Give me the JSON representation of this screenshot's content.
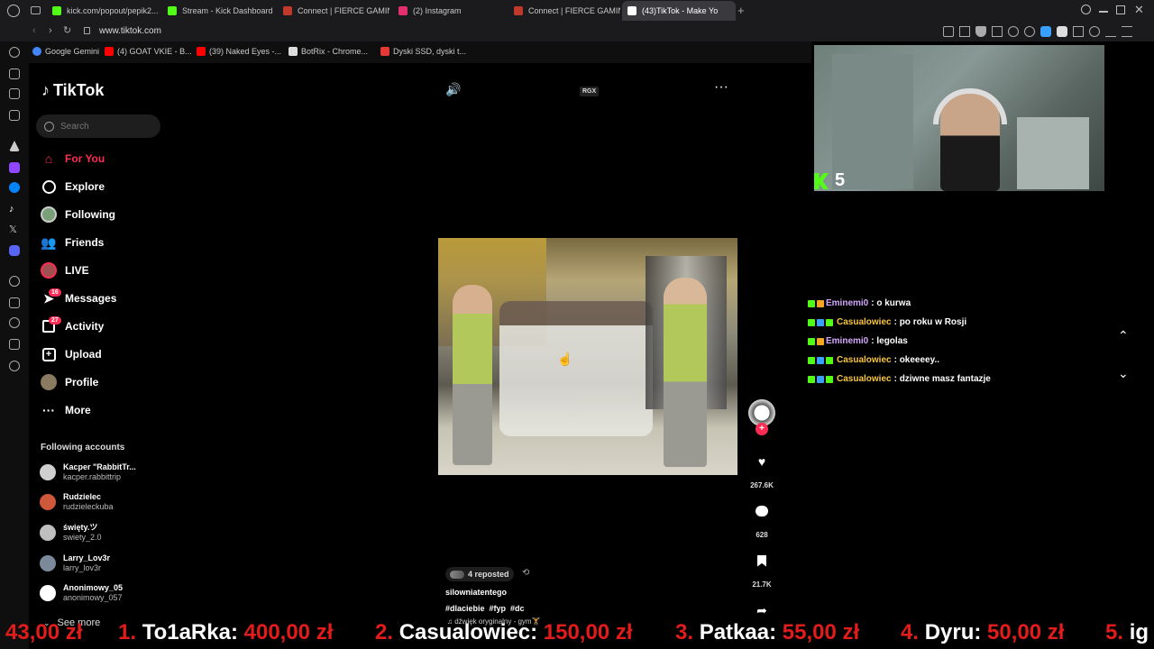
{
  "browser": {
    "tabs": [
      {
        "label": "kick.com/popout/pepik2...",
        "fav": "#53fc18"
      },
      {
        "label": "Stream - Kick Dashboard",
        "fav": "#53fc18"
      },
      {
        "label": "Connect | FIERCE GAMIN",
        "fav": "#c0392b"
      },
      {
        "label": "(2) Instagram",
        "fav": "#e1306c"
      },
      {
        "label": "Connect | FIERCE GAMIN",
        "fav": "#c0392b"
      },
      {
        "label": "(43)TikTok - Make Yo",
        "fav": "#ffffff"
      }
    ],
    "url": "www.tiktok.com",
    "bookmarks": [
      {
        "label": "Google Gemini",
        "fav": "#4285f4"
      },
      {
        "label": "(4) GOAT VKIE - B...",
        "fav": "#ff0000"
      },
      {
        "label": "(39) Naked Eyes -...",
        "fav": "#ff0000"
      },
      {
        "label": "BotRix - Chrome...",
        "fav": "#ffffff"
      },
      {
        "label": "Dyski SSD, dyski t...",
        "fav": "#e53935"
      }
    ]
  },
  "tiktok": {
    "logo": "TikTok",
    "search_placeholder": "Search",
    "nav": [
      {
        "label": "For You",
        "icon": "home-icon"
      },
      {
        "label": "Explore",
        "icon": "compass-icon"
      },
      {
        "label": "Following",
        "icon": "following-icon"
      },
      {
        "label": "Friends",
        "icon": "friends-icon"
      },
      {
        "label": "LIVE",
        "icon": "live-icon"
      },
      {
        "label": "Messages",
        "icon": "messages-icon",
        "badge": "16"
      },
      {
        "label": "Activity",
        "icon": "activity-icon",
        "badge": "27"
      },
      {
        "label": "Upload",
        "icon": "upload-icon"
      },
      {
        "label": "Profile",
        "icon": "profile-icon"
      },
      {
        "label": "More",
        "icon": "more-icon"
      }
    ],
    "following_header": "Following accounts",
    "accounts": [
      {
        "name": "Kacper \"RabbitTr...",
        "handle": "kacper.rabbittrip"
      },
      {
        "name": "Rudzielec",
        "handle": "rudzieleckuba"
      },
      {
        "name": "święty.ツ",
        "handle": "swiety_2.0"
      },
      {
        "name": "Larry_Lov3r",
        "handle": "larry_lov3r"
      },
      {
        "name": "Anonimowy_05",
        "handle": "anonimowy_057"
      }
    ],
    "see_more": "See more",
    "player_badge": "RGX",
    "actions": {
      "likes": "267.6K",
      "comments": "628",
      "saves": "21.7K"
    },
    "reposted": "4 reposted",
    "author": "silowniatentego",
    "hashtags": "#dlaciebie  #fyp  #dc",
    "sound": "♫ dźwięk oryginalny - gym🏋"
  },
  "stream": {
    "viewer_count": "5",
    "chat": [
      {
        "user": "Eminemi0",
        "user_color": "#d4a8ff",
        "message": ": o kurwa",
        "b2": "#f5a623",
        "b3": ""
      },
      {
        "user": "Casualowiec",
        "user_color": "#f5c542",
        "message": ": po roku w Rosji",
        "b2": "#3aa0ff",
        "b3": "#53fc18"
      },
      {
        "user": "Eminemi0",
        "user_color": "#d4a8ff",
        "message": ": legolas",
        "b2": "#f5a623",
        "b3": ""
      },
      {
        "user": "Casualowiec",
        "user_color": "#f5c542",
        "message": ": okeeeey..",
        "b2": "#3aa0ff",
        "b3": "#53fc18"
      },
      {
        "user": "Casualowiec",
        "user_color": "#f5c542",
        "message": ": dziwne masz fantazje",
        "b2": "#3aa0ff",
        "b3": "#53fc18"
      }
    ],
    "ticker": [
      {
        "rank": "",
        "name": "",
        "amount": "43,00 zł"
      },
      {
        "rank": "1.",
        "name": "To1aRka:",
        "amount": "400,00 zł"
      },
      {
        "rank": "2.",
        "name": "Casualowiec:",
        "amount": "150,00 zł"
      },
      {
        "rank": "3.",
        "name": "Patkaa:",
        "amount": "55,00 zł"
      },
      {
        "rank": "4.",
        "name": "Dyru:",
        "amount": "50,00 zł"
      },
      {
        "rank": "5.",
        "name": "ig",
        "amount": ""
      }
    ]
  }
}
